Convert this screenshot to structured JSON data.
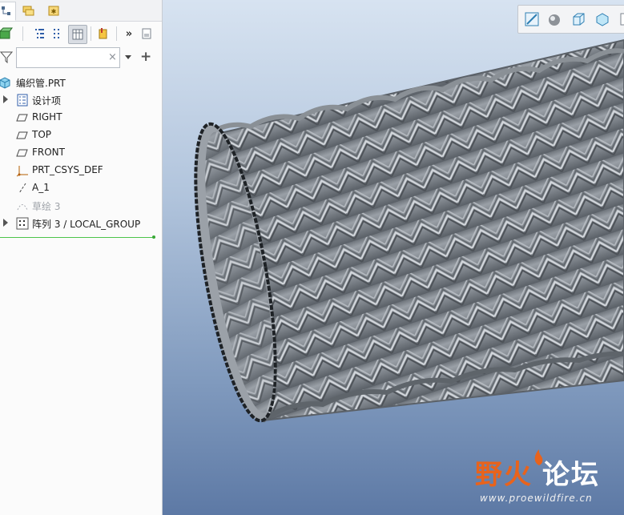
{
  "model_tree": {
    "search": {
      "value": "",
      "placeholder": ""
    },
    "clear_symbol": "×",
    "add_symbol": "+",
    "more_symbol": "»",
    "items": [
      {
        "label": "编织管.PRT",
        "icon": "part-icon",
        "expandable": false
      },
      {
        "label": "设计项",
        "icon": "design-items-icon",
        "expandable": true
      },
      {
        "label": "RIGHT",
        "icon": "datum-plane-icon",
        "expandable": false
      },
      {
        "label": "TOP",
        "icon": "datum-plane-icon",
        "expandable": false
      },
      {
        "label": "FRONT",
        "icon": "datum-plane-icon",
        "expandable": false
      },
      {
        "label": "PRT_CSYS_DEF",
        "icon": "coordinate-system-icon",
        "expandable": false
      },
      {
        "label": "A_1",
        "icon": "datum-axis-icon",
        "expandable": false
      },
      {
        "label": "草绘 3",
        "icon": "sketch-icon",
        "expandable": false,
        "suppressed": true
      },
      {
        "label": "阵列 3 / LOCAL_GROUP",
        "icon": "pattern-icon",
        "expandable": true
      }
    ]
  },
  "view_toolbar": {
    "buttons": [
      "refit-icon",
      "shading-icon",
      "view-box-icon",
      "saved-views-icon",
      "more-icon"
    ]
  },
  "watermark": {
    "title_part1": "野火",
    "title_part2": "论坛",
    "url": "www.proewildfire.cn"
  },
  "colors": {
    "viewport_top": "#d7e3f1",
    "viewport_bottom": "#5d79a5",
    "model_gray": "#8c9299",
    "insert_marker": "#4cc44a",
    "watermark_orange": "#e8631c"
  }
}
